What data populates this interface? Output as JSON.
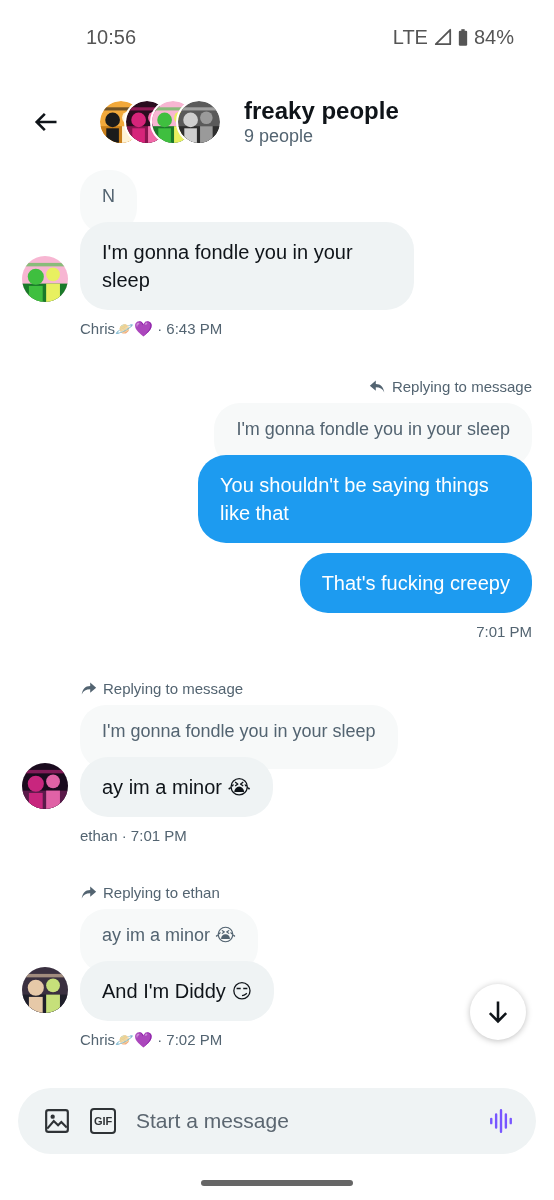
{
  "status_bar": {
    "time": "10:56",
    "network": "LTE",
    "battery": "84%"
  },
  "header": {
    "title": "freaky people",
    "subtitle": "9 people"
  },
  "messages": [
    {
      "kind": "incoming",
      "quote": "N",
      "bubbles": [
        "I'm gonna fondle you in your sleep"
      ],
      "meta": "Chris🪐💜 · 6:43 PM"
    },
    {
      "kind": "outgoing",
      "reply_label": "Replying to message",
      "quote": "I'm gonna fondle you in your sleep",
      "bubbles": [
        "You shouldn't be saying things like that",
        "That's fucking creepy"
      ],
      "meta": "7:01 PM"
    },
    {
      "kind": "incoming",
      "reply_label": "Replying to message",
      "quote": "I'm gonna fondle you in your sleep",
      "bubbles": [
        "ay im a minor 😭"
      ],
      "meta": "ethan · 7:01 PM"
    },
    {
      "kind": "incoming",
      "reply_label": "Replying to ethan",
      "quote": "ay im a minor 😭",
      "bubbles": [
        "And I'm Diddy 😏"
      ],
      "meta": "Chris🪐💜 · 7:02 PM"
    }
  ],
  "composer": {
    "gif_label": "GIF",
    "placeholder": "Start a message"
  }
}
